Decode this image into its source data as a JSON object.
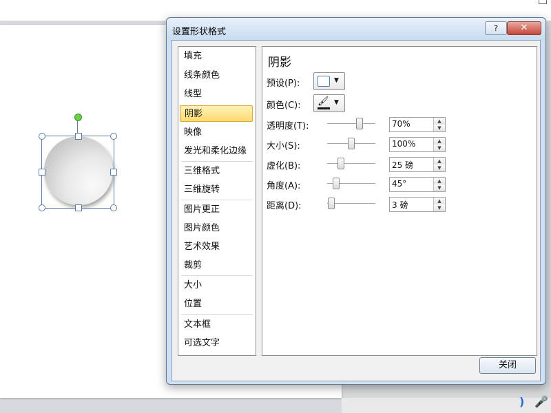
{
  "dialog": {
    "title": "设置形状格式",
    "help_label": "?",
    "close_label": "✕",
    "close_button_label": "关闭"
  },
  "categories": [
    "填充",
    "线条颜色",
    "线型",
    "阴影",
    "映像",
    "发光和柔化边缘",
    "三维格式",
    "三维旋转",
    "图片更正",
    "图片颜色",
    "艺术效果",
    "裁剪",
    "大小",
    "位置",
    "文本框",
    "可选文字"
  ],
  "selected_category": "阴影",
  "shadow": {
    "heading": "阴影",
    "preset_label": "预设(P):",
    "color_label": "颜色(C):",
    "rows": [
      {
        "label": "透明度(T):",
        "value": "70%",
        "level": 0.7
      },
      {
        "label": "大小(S):",
        "value": "100%",
        "level": 0.5
      },
      {
        "label": "虚化(B):",
        "value": "25 磅",
        "level": 0.25
      },
      {
        "label": "角度(A):",
        "value": "45°",
        "level": 0.13
      },
      {
        "label": "距离(D):",
        "value": "3 磅",
        "level": 0.02
      }
    ]
  },
  "icons": {
    "help": "question-icon",
    "close": "close-icon",
    "color_picker": "paint-bucket-icon"
  },
  "colors": {
    "selected_category_bg": "#ffd970",
    "rotation_handle": "#6cd04a",
    "titlebar": "#cfe0f2"
  }
}
